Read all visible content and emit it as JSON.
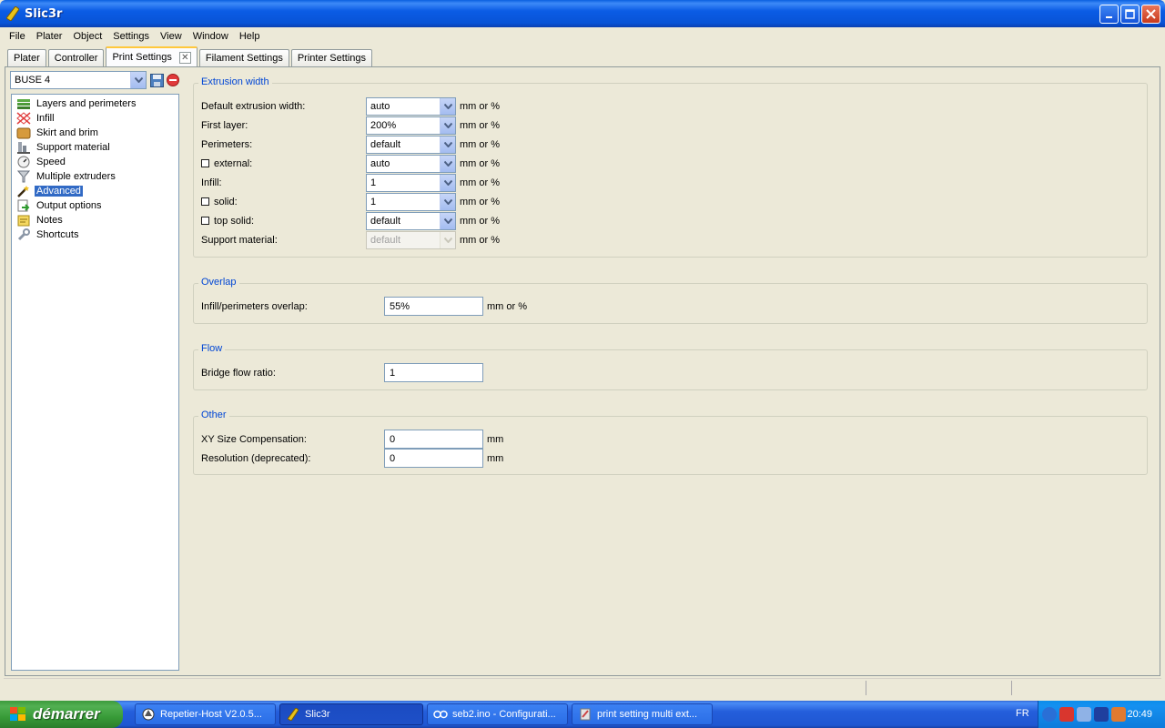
{
  "window": {
    "title": "Slic3r"
  },
  "menu": [
    "File",
    "Plater",
    "Object",
    "Settings",
    "View",
    "Window",
    "Help"
  ],
  "tabs": [
    {
      "label": "Plater",
      "active": false
    },
    {
      "label": "Controller",
      "active": false
    },
    {
      "label": "Print Settings",
      "active": true,
      "closable": true,
      "close_glyph": "✕"
    },
    {
      "label": "Filament Settings",
      "active": false
    },
    {
      "label": "Printer Settings",
      "active": false
    }
  ],
  "preset": {
    "value": "BUSE 4"
  },
  "tree": [
    {
      "label": "Layers and perimeters",
      "icon": "layers-icon"
    },
    {
      "label": "Infill",
      "icon": "infill-icon"
    },
    {
      "label": "Skirt and brim",
      "icon": "skirt-icon"
    },
    {
      "label": "Support material",
      "icon": "support-icon"
    },
    {
      "label": "Speed",
      "icon": "speed-icon"
    },
    {
      "label": "Multiple extruders",
      "icon": "funnel-icon"
    },
    {
      "label": "Advanced",
      "icon": "wand-icon",
      "selected": true
    },
    {
      "label": "Output options",
      "icon": "output-icon"
    },
    {
      "label": "Notes",
      "icon": "note-icon"
    },
    {
      "label": "Shortcuts",
      "icon": "wrench-icon"
    }
  ],
  "groups": {
    "extrusion": {
      "title": "Extrusion width",
      "rows": [
        {
          "label": "Default extrusion width:",
          "value": "auto",
          "unit": "mm or %"
        },
        {
          "label": "First layer:",
          "value": "200%",
          "unit": "mm or %"
        },
        {
          "label": "Perimeters:",
          "value": "default",
          "unit": "mm or %"
        },
        {
          "label": "external:",
          "value": "auto",
          "unit": "mm or %",
          "checkbox": true
        },
        {
          "label": "Infill:",
          "value": "1",
          "unit": "mm or %"
        },
        {
          "label": "solid:",
          "value": "1",
          "unit": "mm or %",
          "checkbox": true
        },
        {
          "label": "top solid:",
          "value": "default",
          "unit": "mm or %",
          "checkbox": true
        },
        {
          "label": "Support material:",
          "value": "default",
          "unit": "mm or %",
          "disabled": true
        }
      ]
    },
    "overlap": {
      "title": "Overlap",
      "rows": [
        {
          "label": "Infill/perimeters overlap:",
          "value": "55%",
          "unit": "mm or %"
        }
      ]
    },
    "flow": {
      "title": "Flow",
      "rows": [
        {
          "label": "Bridge flow ratio:",
          "value": "1",
          "unit": ""
        }
      ]
    },
    "other": {
      "title": "Other",
      "rows": [
        {
          "label": "XY Size Compensation:",
          "value": "0",
          "unit": "mm"
        },
        {
          "label": "Resolution (deprecated):",
          "value": "0",
          "unit": "mm"
        }
      ]
    }
  },
  "taskbar": {
    "start_label": "démarrer",
    "tasks": [
      {
        "label": "Repetier-Host V2.0.5...",
        "icon": "repetier-icon"
      },
      {
        "label": "Slic3r",
        "icon": "slic3r-icon",
        "active": true
      },
      {
        "label": "seb2.ino - Configurati...",
        "icon": "arduino-icon"
      },
      {
        "label": "print setting multi ext...",
        "icon": "paint-icon"
      }
    ],
    "language": "FR",
    "clock": "20:49"
  },
  "colors": {
    "accent": "#316AC5",
    "group_title": "#0046D5",
    "window_bg": "#ECE9D8"
  }
}
